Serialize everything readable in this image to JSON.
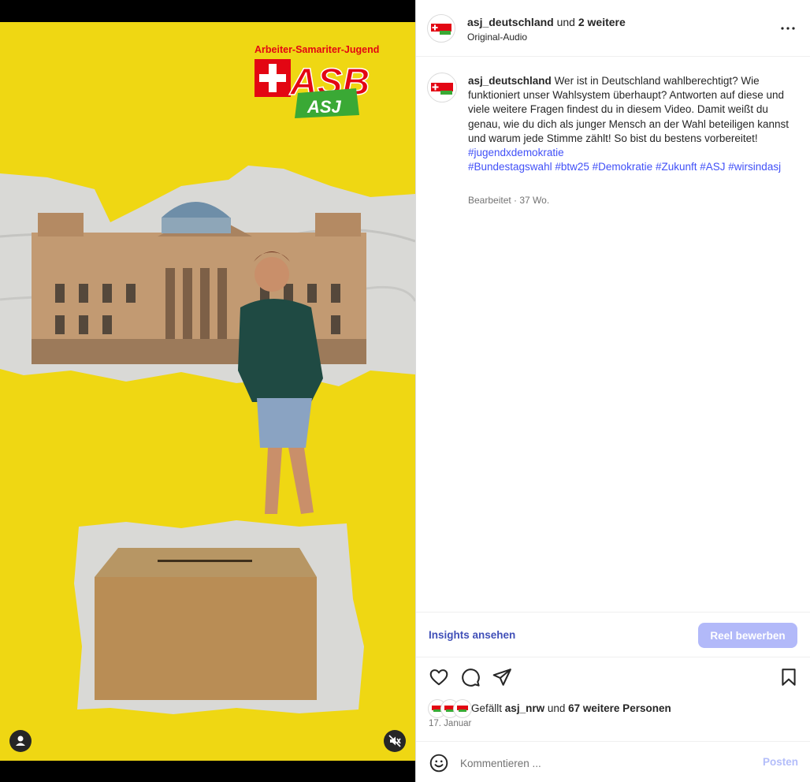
{
  "header": {
    "username": "asj_deutschland",
    "and_text": "und",
    "others": "2 weitere",
    "audio": "Original-Audio"
  },
  "caption": {
    "username": "asj_deutschland",
    "text": "Wer ist in Deutschland wahlberechtigt? Wie funktioniert unser Wahlsystem überhaupt? Antworten auf diese und viele weitere Fragen findest du in diesem Video. Damit weißt du genau, wie du dich als junger Mensch an der Wahl beteiligen kannst und warum jede Stimme zählt! So bist du bestens vorbereitet!",
    "hashtags": [
      "#jugendxdemokratie",
      "#Bundestagswahl",
      "#btw25",
      "#Demokratie",
      "#Zukunft",
      "#ASJ",
      "#wirsindasj"
    ],
    "edited": "Bearbeitet",
    "age": "37 Wo."
  },
  "media": {
    "logo_tagline": "Arbeiter-Samariter-Jugend",
    "logo_main": "ASB",
    "logo_sub": "ASJ",
    "background_color": "#ffe400"
  },
  "insights": {
    "link_label": "Insights ansehen",
    "promote_label": "Reel bewerben"
  },
  "likes": {
    "prefix": "Gefällt",
    "user": "asj_nrw",
    "and_text": "und",
    "count_text": "67 weitere Personen"
  },
  "date": "17. Januar",
  "comment": {
    "placeholder": "Kommentieren ...",
    "post_label": "Posten"
  }
}
